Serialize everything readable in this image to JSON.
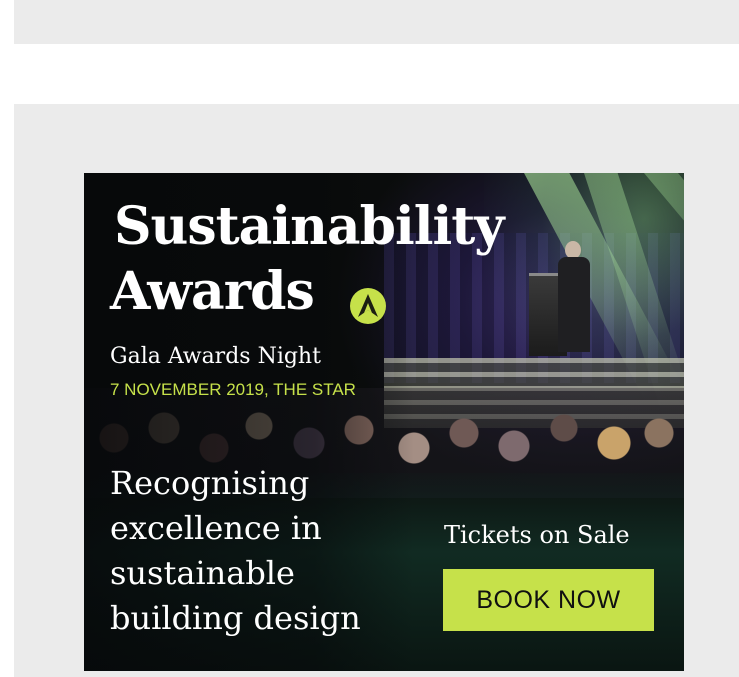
{
  "ad": {
    "title_line1": "Sustainability",
    "title_line2": "Awards",
    "logo_icon": "triangle-a-logo-icon",
    "subtitle": "Gala Awards Night",
    "date_venue": "7 NOVEMBER 2019, THE STAR",
    "tagline": [
      "Recognising",
      "excellence in",
      "sustainable",
      "building design"
    ],
    "tickets_text": "Tickets on Sale",
    "cta_label": "BOOK NOW"
  },
  "colors": {
    "page_background": "#ffffff",
    "placeholder_gray": "#ebebeb",
    "accent_lime": "#c6e14a",
    "banner_dark": "#0b0d0c",
    "banner_green": "#12302a"
  }
}
